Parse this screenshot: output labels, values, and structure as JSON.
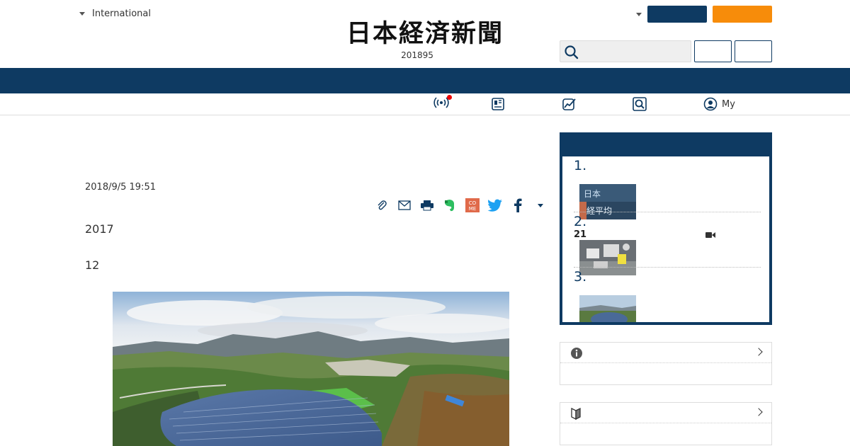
{
  "header": {
    "region_label": "International",
    "logo_text": "日本経済新聞",
    "date_text": "201895"
  },
  "subnav": {
    "my_label": "My"
  },
  "article": {
    "timestamp": "2018/9/5 19:51",
    "para1": "2017",
    "para2": "12"
  },
  "ranking": {
    "items": [
      {
        "num": "1."
      },
      {
        "num": "2.",
        "sub": "21"
      },
      {
        "num": "3."
      }
    ]
  },
  "colors": {
    "navy": "#0e3a62",
    "orange": "#f78c0a"
  }
}
